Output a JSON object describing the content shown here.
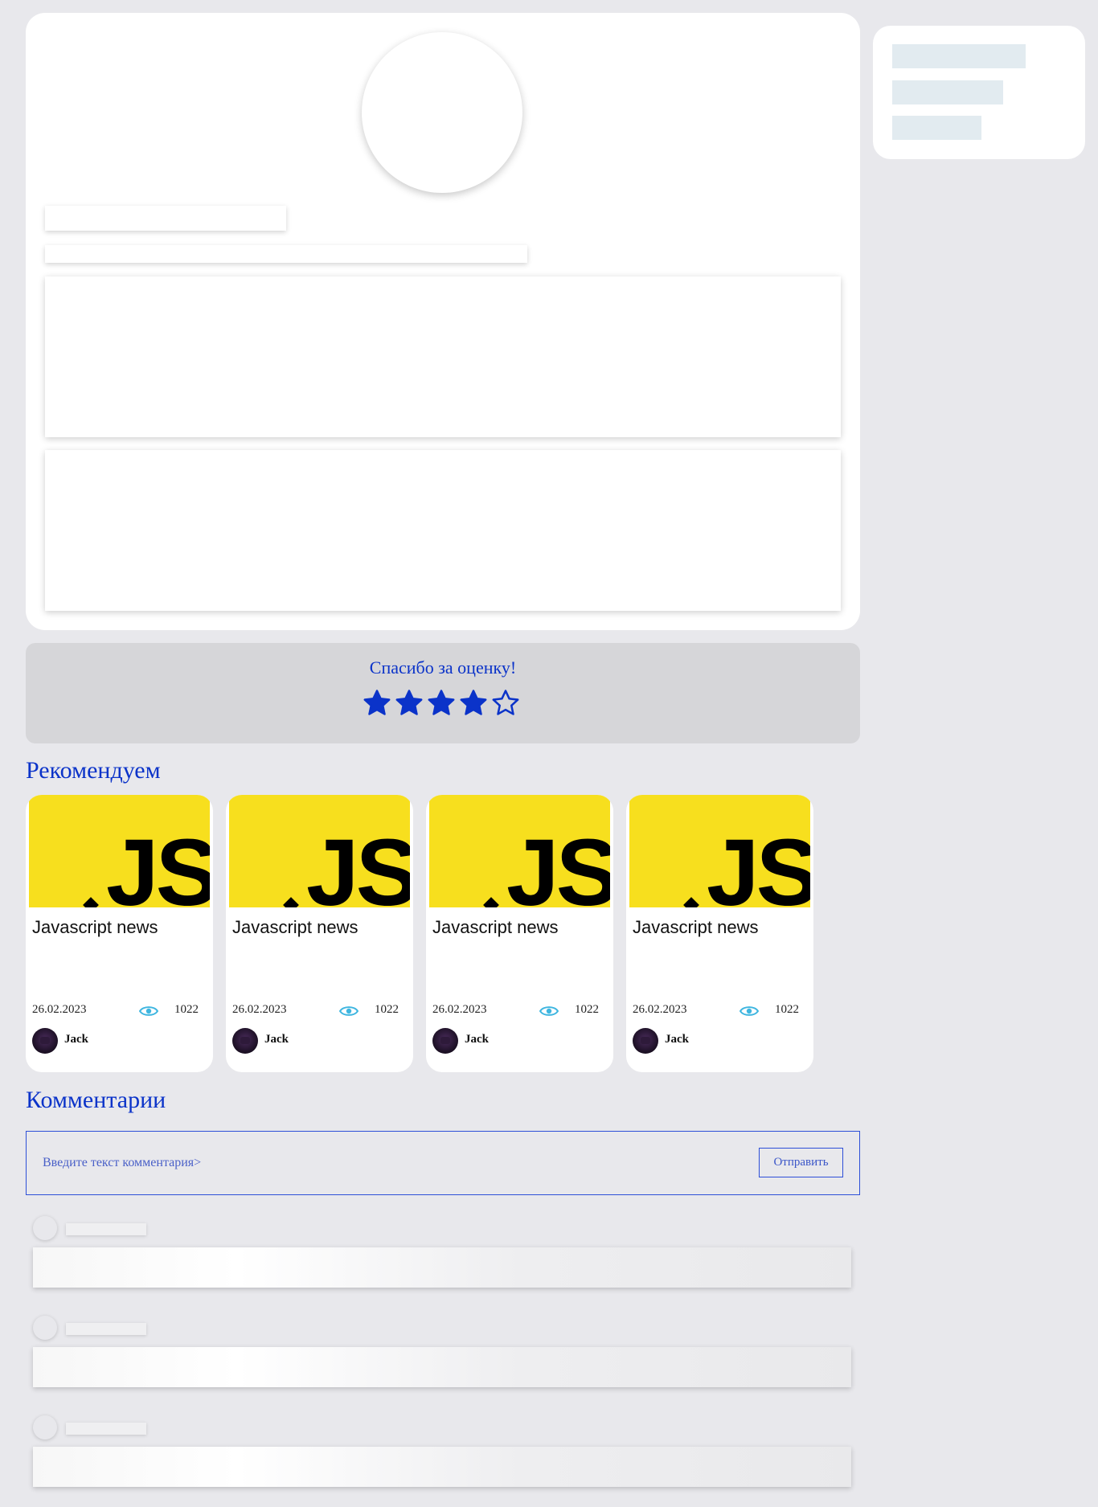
{
  "rating": {
    "thanks_text": "Спасибо за оценку!",
    "value": 4,
    "max": 5,
    "color": "#0b33c9"
  },
  "recommendations": {
    "title": "Рекомендуем",
    "items": [
      {
        "title": "Javascript news",
        "thumb_text": "JS",
        "date": "26.02.2023",
        "views": "1022",
        "author": "Jack"
      },
      {
        "title": "Javascript news",
        "thumb_text": "JS",
        "date": "26.02.2023",
        "views": "1022",
        "author": "Jack"
      },
      {
        "title": "Javascript news",
        "thumb_text": "JS",
        "date": "26.02.2023",
        "views": "1022",
        "author": "Jack"
      },
      {
        "title": "Javascript news",
        "thumb_text": "JS",
        "date": "26.02.2023",
        "views": "1022",
        "author": "Jack"
      }
    ]
  },
  "comments": {
    "title": "Комментарии",
    "input_placeholder": "Введите текст комментария>",
    "send_label": "Отправить"
  },
  "colors": {
    "accent": "#0b33c9",
    "page_bg": "#e8e8ec",
    "js_yellow": "#f7df1e",
    "eye_icon": "#3fb6e0"
  }
}
